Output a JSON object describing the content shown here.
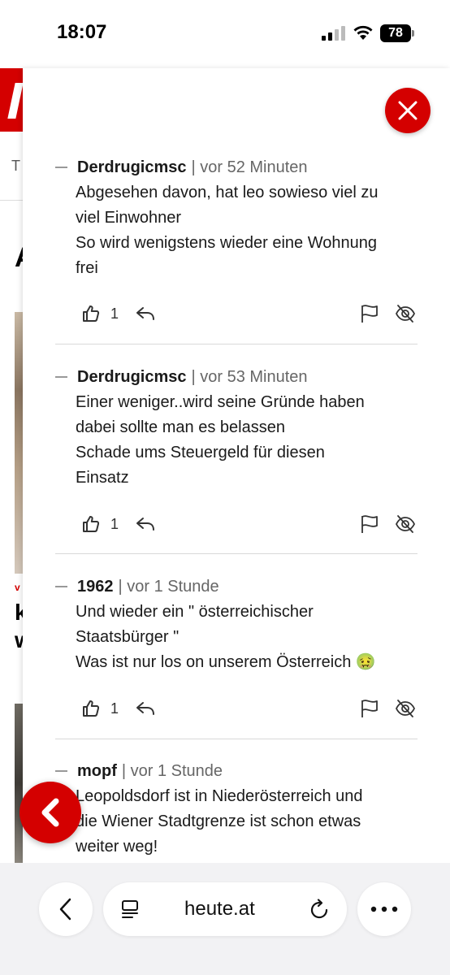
{
  "status_bar": {
    "time": "18:07",
    "battery": "78"
  },
  "background": {
    "nav_text": "T",
    "headline_letter": "A",
    "tag_letter": "v",
    "line1": "k",
    "line2": "w"
  },
  "comments": [
    {
      "author": "Derdrugicmsc",
      "meta": "| vor 52 Minuten",
      "lines": [
        "Abgesehen davon, hat leo sowieso viel zu",
        "viel Einwohner",
        "So wird wenigstens wieder eine Wohnung",
        "frei"
      ],
      "likes": "1"
    },
    {
      "author": "Derdrugicmsc",
      "meta": "| vor 53 Minuten",
      "lines": [
        "Einer weniger..wird seine Gründe haben",
        "dabei sollte man es belassen",
        "Schade ums Steuergeld für diesen",
        "Einsatz"
      ],
      "likes": "1"
    },
    {
      "author": "1962",
      "meta": "| vor 1 Stunde",
      "lines": [
        "Und wieder ein \" österreichischer",
        "Staatsbürger \"",
        "Was ist nur los on unserem Österreich 🤢"
      ],
      "likes": "1"
    },
    {
      "author": "mopf",
      "meta": "| vor 1 Stunde",
      "lines": [
        "Leopoldsdorf ist in Niederösterreich und",
        "die Wiener Stadtgrenze ist schon etwas",
        "weiter weg!"
      ]
    }
  ],
  "browser": {
    "url": "heute.at"
  },
  "colors": {
    "accent": "#d40000",
    "text": "#1a1a1a",
    "meta": "#666666",
    "divider": "#d9d9d9"
  },
  "icons": [
    "close-icon",
    "thumbs-up-icon",
    "reply-icon",
    "flag-icon",
    "hide-icon",
    "chevron-left-icon",
    "reader-icon",
    "reload-icon",
    "more-icon"
  ]
}
